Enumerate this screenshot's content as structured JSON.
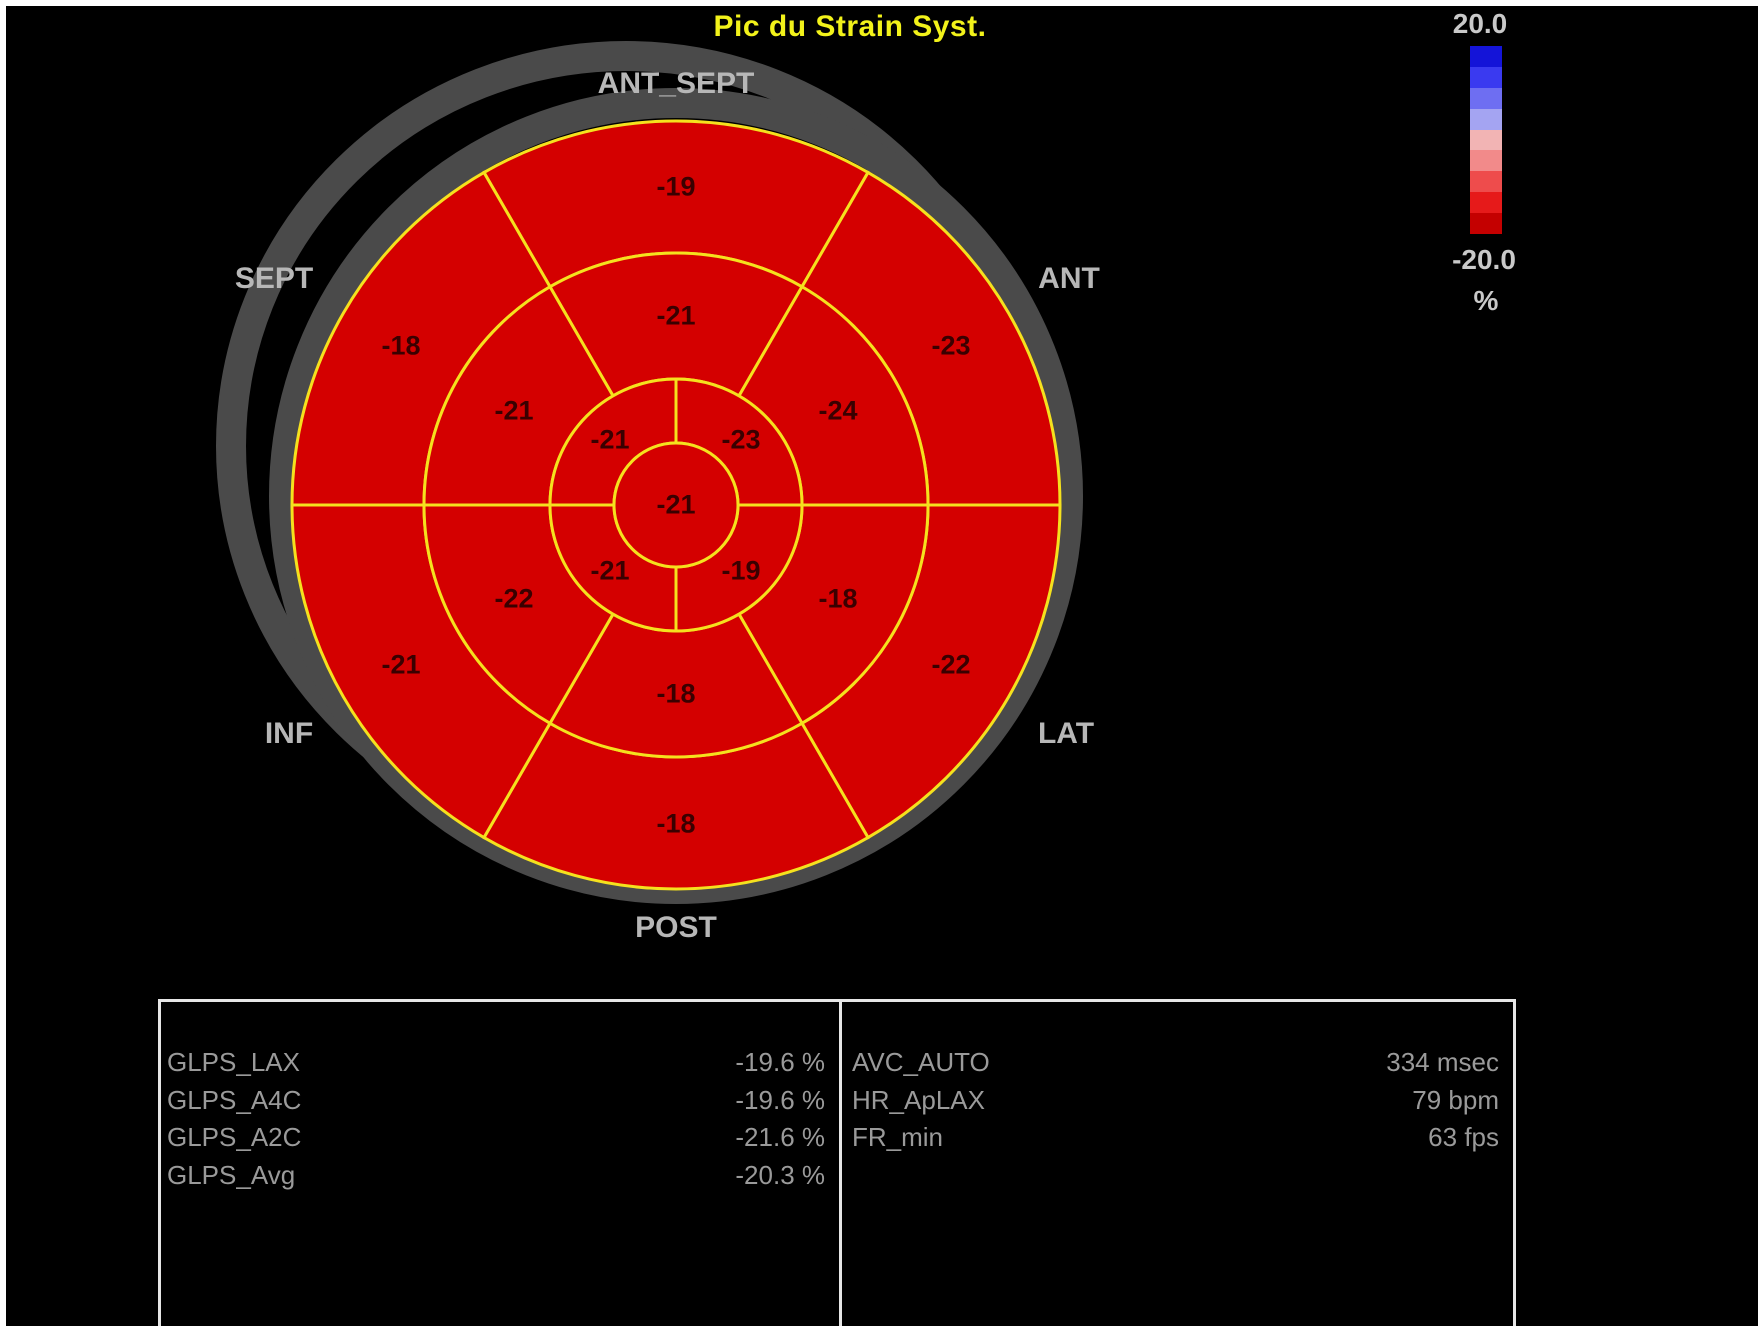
{
  "title": "Pic du Strain Syst.",
  "scale": {
    "max": "20.0",
    "min": "-20.0",
    "unit": "%"
  },
  "scale_colors": [
    "#1414d8",
    "#3a3af0",
    "#6e6ef2",
    "#a4a4f2",
    "#f2b4b4",
    "#f28a8a",
    "#ee4c4c",
    "#e61a1a",
    "#c40000"
  ],
  "colors": {
    "segment_fill": "#d40000",
    "segment_border": "#f5e11e",
    "ring": "#4a4a4a",
    "background": "#000000",
    "title": "#f2f21a"
  },
  "walls": {
    "ant_sept": "ANT_SEPT",
    "ant": "ANT",
    "lat": "LAT",
    "post": "POST",
    "inf": "INF",
    "sept": "SEPT"
  },
  "segments": {
    "basal": {
      "ant_sept": "-19",
      "ant": "-23",
      "lat": "-22",
      "post": "-18",
      "inf": "-21",
      "sept": "-18"
    },
    "mid": {
      "ant_sept": "-21",
      "ant": "-24",
      "lat": "-18",
      "post": "-18",
      "inf": "-22",
      "sept": "-21"
    },
    "apical": {
      "anterior": "-23",
      "lateral": "-19",
      "inferior": "-21",
      "septal": "-21"
    },
    "apex": "-21"
  },
  "measurements_left": [
    {
      "label": "GLPS_LAX",
      "value": "-19.6 %"
    },
    {
      "label": "GLPS_A4C",
      "value": "-19.6 %"
    },
    {
      "label": "GLPS_A2C",
      "value": "-21.6 %"
    },
    {
      "label": "GLPS_Avg",
      "value": "-20.3 %"
    }
  ],
  "measurements_right": [
    {
      "label": "AVC_AUTO",
      "value": "334 msec"
    },
    {
      "label": "HR_ApLAX",
      "value": "79 bpm"
    },
    {
      "label": "FR_min",
      "value": "63 fps"
    }
  ]
}
